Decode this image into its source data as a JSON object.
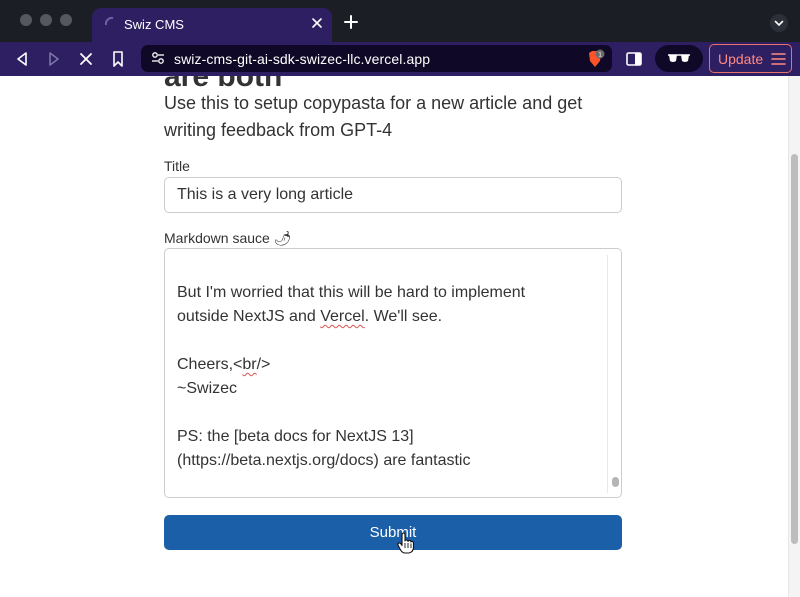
{
  "browser": {
    "tab": {
      "title": "Swiz CMS"
    },
    "address_bar": {
      "url": "swiz-cms-git-ai-sdk-swizec-llc.vercel.app"
    },
    "shield_badge": "1",
    "update_label": "Update"
  },
  "page": {
    "heading_partial": "are both",
    "description": "Use this to setup copypasta for a new article and get writing feedback from GPT-4",
    "title_label": "Title",
    "title_value": "This is a very long article",
    "markdown_label": "Markdown sauce 🌶",
    "markdown_lines": [
      "But I'm worried that this will be hard to implement",
      "outside NextJS and",
      "Vercel",
      ". We'll see.",
      "Cheers,<",
      "br",
      "/>",
      "~Swizec",
      "PS: the [beta docs for NextJS 13]",
      "(https://beta.nextjs.org/docs) are fantastic"
    ],
    "submit_label": "Submit"
  },
  "colors": {
    "accent": "#1b5fa8",
    "tab_bar": "#1b1e25",
    "toolbar": "#2e1f63",
    "update": "#ff8a80"
  }
}
